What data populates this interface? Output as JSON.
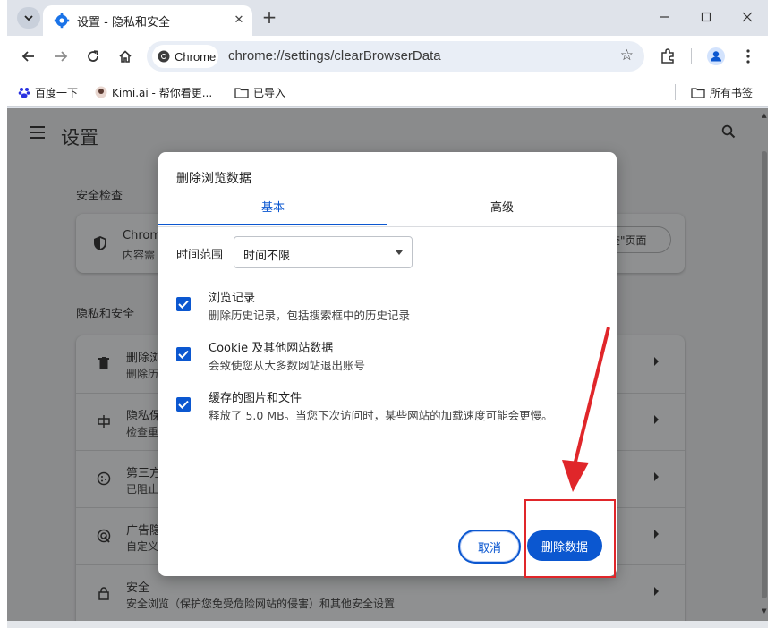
{
  "browser": {
    "tab_title": "设置 - 隐私和安全",
    "tab_close": "✕",
    "new_tab": "+",
    "omnibox_chip": "Chrome",
    "url": "chrome://settings/clearBrowserData",
    "bookmarks": [
      {
        "label": "百度一下"
      },
      {
        "label": "Kimi.ai - 帮你看更..."
      },
      {
        "label": "已导入"
      }
    ],
    "bookmarks_right": "所有书签"
  },
  "settings": {
    "title": "设置",
    "safety_section": "安全检查",
    "safety_row_title": "Chrom",
    "safety_row_sub": "内容需",
    "safety_button": "查\"页面",
    "privacy_section": "隐私和安全",
    "privacy_rows": [
      {
        "title": "删除浏",
        "sub": "删除历",
        "icon": "trash-icon"
      },
      {
        "title": "隐私保",
        "sub": "检查重",
        "icon": "privacy-guide-icon"
      },
      {
        "title": "第三方",
        "sub": "已阻止",
        "icon": "cookie-icon"
      },
      {
        "title": "广告隐",
        "sub": "自定义",
        "icon": "ad-privacy-icon"
      },
      {
        "title": "安全",
        "sub": "安全浏览（保护您免受危险网站的侵害）和其他安全设置",
        "icon": "lock-icon"
      }
    ]
  },
  "dialog": {
    "title": "删除浏览数据",
    "tabs": [
      "基本",
      "高级"
    ],
    "range_label": "时间范围",
    "range_value": "时间不限",
    "options": [
      {
        "title": "浏览记录",
        "sub": "删除历史记录，包括搜索框中的历史记录",
        "checked": true
      },
      {
        "title": "Cookie 及其他网站数据",
        "sub": "会致使您从大多数网站退出账号",
        "checked": true
      },
      {
        "title": "缓存的图片和文件",
        "sub": "释放了 5.0 MB。当您下次访问时，某些网站的加载速度可能会更慢。",
        "checked": true
      }
    ],
    "cancel_label": "取消",
    "delete_label": "删除数据"
  },
  "colors": {
    "accent": "#0b57d0",
    "annotation_red": "#e0262a"
  }
}
